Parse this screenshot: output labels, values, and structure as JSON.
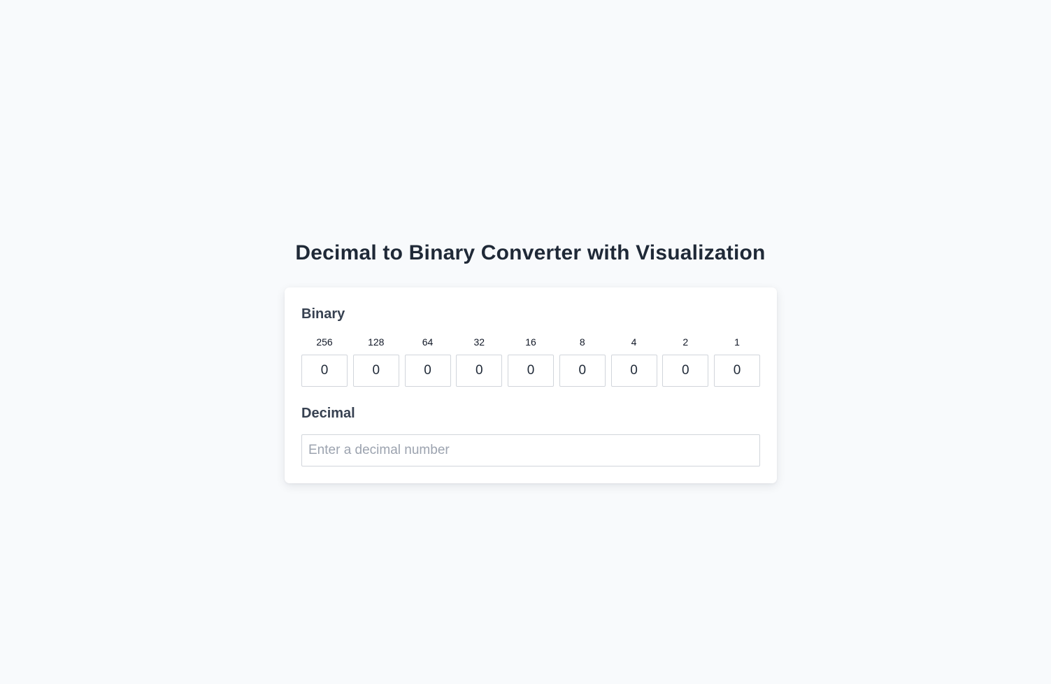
{
  "page": {
    "title": "Decimal to Binary Converter with Visualization"
  },
  "binary": {
    "label": "Binary",
    "bits": [
      {
        "weight": "256",
        "value": "0"
      },
      {
        "weight": "128",
        "value": "0"
      },
      {
        "weight": "64",
        "value": "0"
      },
      {
        "weight": "32",
        "value": "0"
      },
      {
        "weight": "16",
        "value": "0"
      },
      {
        "weight": "8",
        "value": "0"
      },
      {
        "weight": "4",
        "value": "0"
      },
      {
        "weight": "2",
        "value": "0"
      },
      {
        "weight": "1",
        "value": "0"
      }
    ]
  },
  "decimal": {
    "label": "Decimal",
    "value": "",
    "placeholder": "Enter a decimal number"
  },
  "colors": {
    "background": "#f8fafc",
    "card": "#ffffff",
    "title": "#1f2937",
    "border": "#d1d5db"
  }
}
